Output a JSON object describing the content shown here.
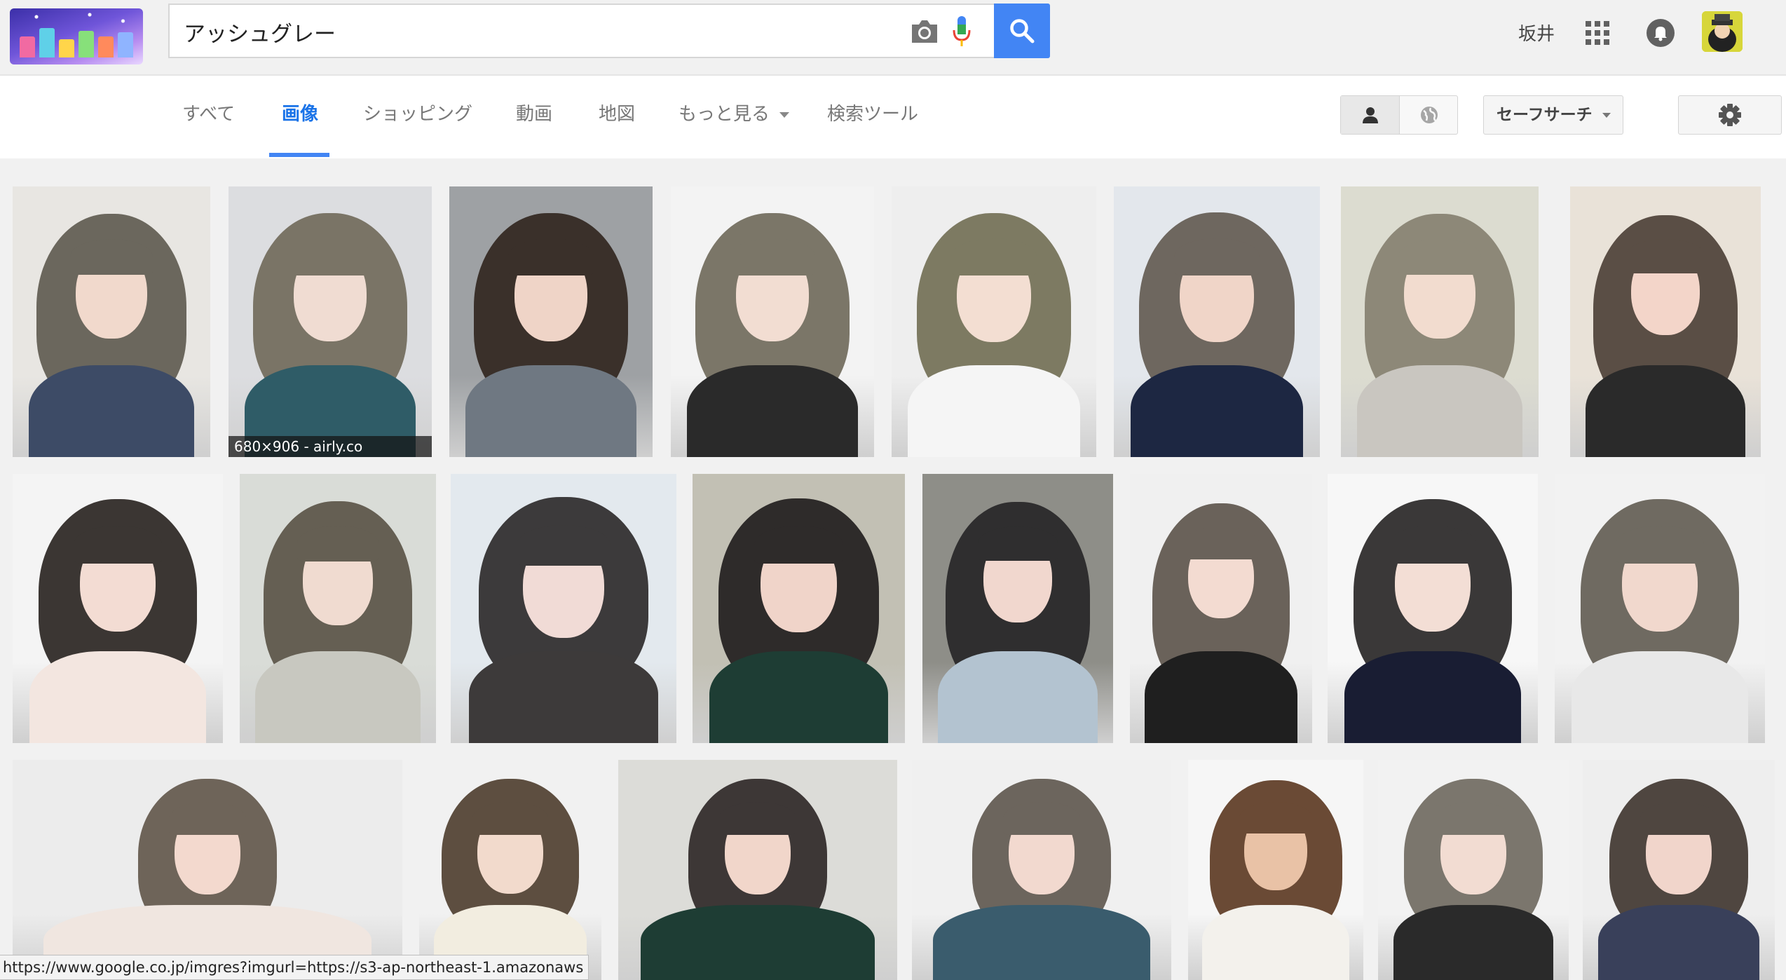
{
  "search": {
    "query": "アッシュグレー"
  },
  "header": {
    "user_name": "坂井"
  },
  "nav": {
    "tabs": [
      {
        "label": "すべて"
      },
      {
        "label": "画像"
      },
      {
        "label": "ショッピング"
      },
      {
        "label": "動画"
      },
      {
        "label": "地図"
      },
      {
        "label": "もっと見る"
      },
      {
        "label": "検索ツール"
      }
    ],
    "active_tab": "画像",
    "safesearch_label": "セーフサーチ"
  },
  "icons": {
    "camera": "camera-icon",
    "mic": "mic-icon",
    "search": "search-icon",
    "apps": "apps-grid-icon",
    "notifications": "bell-icon",
    "person": "person-icon",
    "globe": "globe-icon",
    "settings": "gear-icon"
  },
  "colors": {
    "accent_blue": "#4285f4",
    "page_background": "#f1f1f1"
  },
  "results": {
    "hover_caption": "680×906 - airly.co",
    "rows": [
      [
        {
          "hair": "#6b675d",
          "bg": "#e8e6e2",
          "cloth": "#3d4b66",
          "skin": "#f1d9cc"
        },
        {
          "hair": "#7a7466",
          "bg": "#dcdde0",
          "cloth": "#2f5c67",
          "skin": "#f0dcd2"
        },
        {
          "hair": "#3a302a",
          "bg": "#9ea1a4",
          "cloth": "#6f7882",
          "skin": "#efd4c7"
        },
        {
          "hair": "#7b7668",
          "bg": "#f3f3f3",
          "cloth": "#2a2a2a",
          "skin": "#f2ddd2"
        },
        {
          "hair": "#7d7a62",
          "bg": "#eeeeee",
          "cloth": "#f5f5f5",
          "skin": "#f3ded2"
        },
        {
          "hair": "#6e675f",
          "bg": "#e3e7ec",
          "cloth": "#1d2742",
          "skin": "#f0d5c8"
        },
        {
          "hair": "#8d8878",
          "bg": "#dcdcd0",
          "cloth": "#c9c6c0",
          "skin": "#f2dccf"
        },
        {
          "hair": "#5a4e45",
          "bg": "#e9e2d8",
          "cloth": "#2a2a2a",
          "skin": "#f3d5c9"
        }
      ],
      [
        {
          "hair": "#3b3633",
          "bg": "#f4f4f4",
          "cloth": "#f3e6e0",
          "skin": "#f3dcd3"
        },
        {
          "hair": "#655f53",
          "bg": "#d9dcd7",
          "cloth": "#c8c8c0",
          "skin": "#f0dbd0"
        },
        {
          "hair": "#3c3a3b",
          "bg": "#e3e9ee",
          "cloth": "#3d3a3a",
          "skin": "#f1dbd6"
        },
        {
          "hair": "#2e2b2a",
          "bg": "#c2c0b4",
          "cloth": "#1e3d34",
          "skin": "#f0d4c9"
        },
        {
          "hair": "#2f2e2f",
          "bg": "#8e8e88",
          "cloth": "#b3c3d0",
          "skin": "#f1d7ce"
        },
        {
          "hair": "#6a625a",
          "bg": "#f0f0f0",
          "cloth": "#1f1f1f",
          "skin": "#f3dbd1"
        },
        {
          "hair": "#3a3838",
          "bg": "#f7f7f7",
          "cloth": "#191d33",
          "skin": "#f3ded5"
        },
        {
          "hair": "#6f6a61",
          "bg": "#f2f2f2",
          "cloth": "#e8e8e8",
          "skin": "#f1d8cd"
        }
      ],
      [
        {
          "hair": "#6e6459",
          "bg": "#ececec",
          "cloth": "#f0e6e0",
          "skin": "#f3d9ce"
        },
        {
          "hair": "#5d4e40",
          "bg": "#f1f1f1",
          "cloth": "#f2ede0",
          "skin": "#f2dacc"
        },
        {
          "hair": "#3d3736",
          "bg": "#dcdcd8",
          "cloth": "#1e3d34",
          "skin": "#f1d6ca"
        },
        {
          "hair": "#6c655d",
          "bg": "#f0f0f0",
          "cloth": "#3a5c6d",
          "skin": "#f2d9cf"
        },
        {
          "hair": "#6a4a35",
          "bg": "#f6f6f6",
          "cloth": "#f3f1ec",
          "skin": "#e9c2a6"
        },
        {
          "hair": "#7b766d",
          "bg": "#f2f2f2",
          "cloth": "#2a2a2a",
          "skin": "#f2dcd2"
        },
        {
          "hair": "#4f4640",
          "bg": "#eeeeee",
          "cloth": "#39405a",
          "skin": "#f1d5cb"
        }
      ]
    ]
  },
  "status_bar": {
    "url": "https://www.google.co.jp/imgres?imgurl=https://s3-ap-northeast-1.amazonaws"
  }
}
